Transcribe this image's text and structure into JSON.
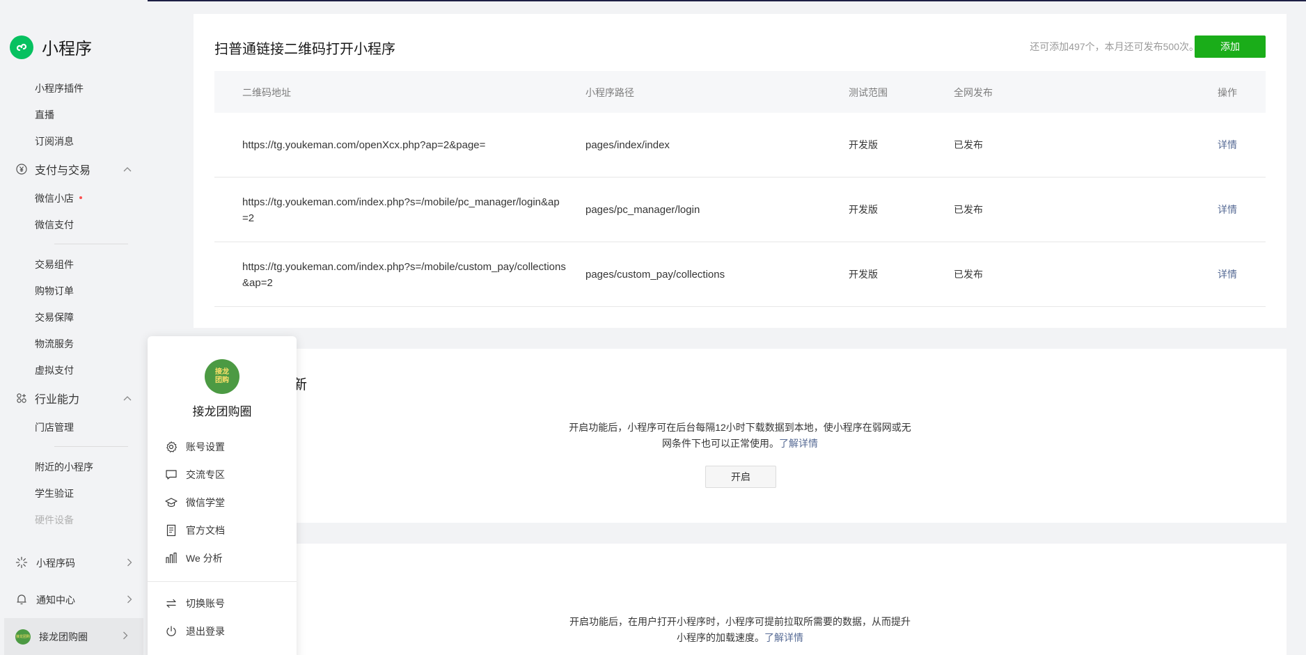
{
  "brand": {
    "title": "小程序"
  },
  "sidebar": {
    "items_top": [
      {
        "label": "小程序插件"
      },
      {
        "label": "直播"
      },
      {
        "label": "订阅消息"
      }
    ],
    "group_pay": {
      "label": "支付与交易",
      "items_a": [
        {
          "label": "微信小店"
        },
        {
          "label": "微信支付"
        }
      ],
      "items_b": [
        {
          "label": "交易组件"
        },
        {
          "label": "购物订单"
        },
        {
          "label": "交易保障"
        },
        {
          "label": "物流服务"
        },
        {
          "label": "虚拟支付"
        }
      ]
    },
    "group_industry": {
      "label": "行业能力",
      "items_a": [
        {
          "label": "门店管理"
        }
      ],
      "items_b": [
        {
          "label": "附近的小程序"
        },
        {
          "label": "学生验证"
        },
        {
          "label": "硬件设备"
        }
      ]
    },
    "bottom": [
      {
        "label": "小程序码"
      },
      {
        "label": "通知中心"
      }
    ],
    "account": {
      "label": "接龙团购圈",
      "avatar_text": "接龙团购"
    }
  },
  "qr_section": {
    "title": "扫普通链接二维码打开小程序",
    "quota": "还可添加497个，本月还可发布500次。",
    "add_label": "添加",
    "columns": [
      "二维码地址",
      "小程序路径",
      "测试范围",
      "全网发布",
      "操作"
    ],
    "rows": [
      {
        "url_line1": "https://tg.youkeman.com/openXcx.php?ap=2&page=",
        "url_line2": "",
        "path": "pages/index/index",
        "scope": "开发版",
        "status": "已发布",
        "action": "详情"
      },
      {
        "url_line1": "https://tg.youkeman.com/index.php?s=/mobile/pc_manager/login&ap",
        "url_line2": "=2",
        "path": "pages/pc_manager/login",
        "scope": "开发版",
        "status": "已发布",
        "action": "详情"
      },
      {
        "url_line1": "https://tg.youkeman.com/index.php?s=/mobile/custom_pay/collections",
        "url_line2": "&ap=2",
        "path": "pages/custom_pay/collections",
        "scope": "开发版",
        "status": "已发布",
        "action": "详情"
      }
    ]
  },
  "prefetch_section": {
    "title_partial": "新",
    "desc_line1": "开启功能后，小程序可在后台每隔12小时下载数据到本地，使小程序在弱网或无",
    "desc_line2": "网条件下也可以正常使用。",
    "learn_more": "了解详情",
    "open_label": "开启"
  },
  "preload_section": {
    "desc_line1": "开启功能后，在用户打开小程序时，小程序可提前拉取所需要的数据，从而提升",
    "desc_line2": "小程序的加载速度。",
    "learn_more": "了解详情"
  },
  "popover": {
    "avatar_line1": "接龙",
    "avatar_line2": "团购",
    "name": "接龙团购圈",
    "items": [
      {
        "label": "账号设置",
        "icon": "gear-icon"
      },
      {
        "label": "交流专区",
        "icon": "chat-icon"
      },
      {
        "label": "微信学堂",
        "icon": "graduation-cap-icon"
      },
      {
        "label": "官方文档",
        "icon": "document-icon"
      },
      {
        "label": "We 分析",
        "icon": "analytics-icon"
      }
    ],
    "items_bottom": [
      {
        "label": "切换账号",
        "icon": "switch-icon"
      },
      {
        "label": "退出登录",
        "icon": "power-icon"
      }
    ]
  },
  "colors": {
    "brand_green": "#07c160",
    "button_green": "#1aad19",
    "link_blue": "#576b95",
    "alert_red": "#fa5151"
  }
}
